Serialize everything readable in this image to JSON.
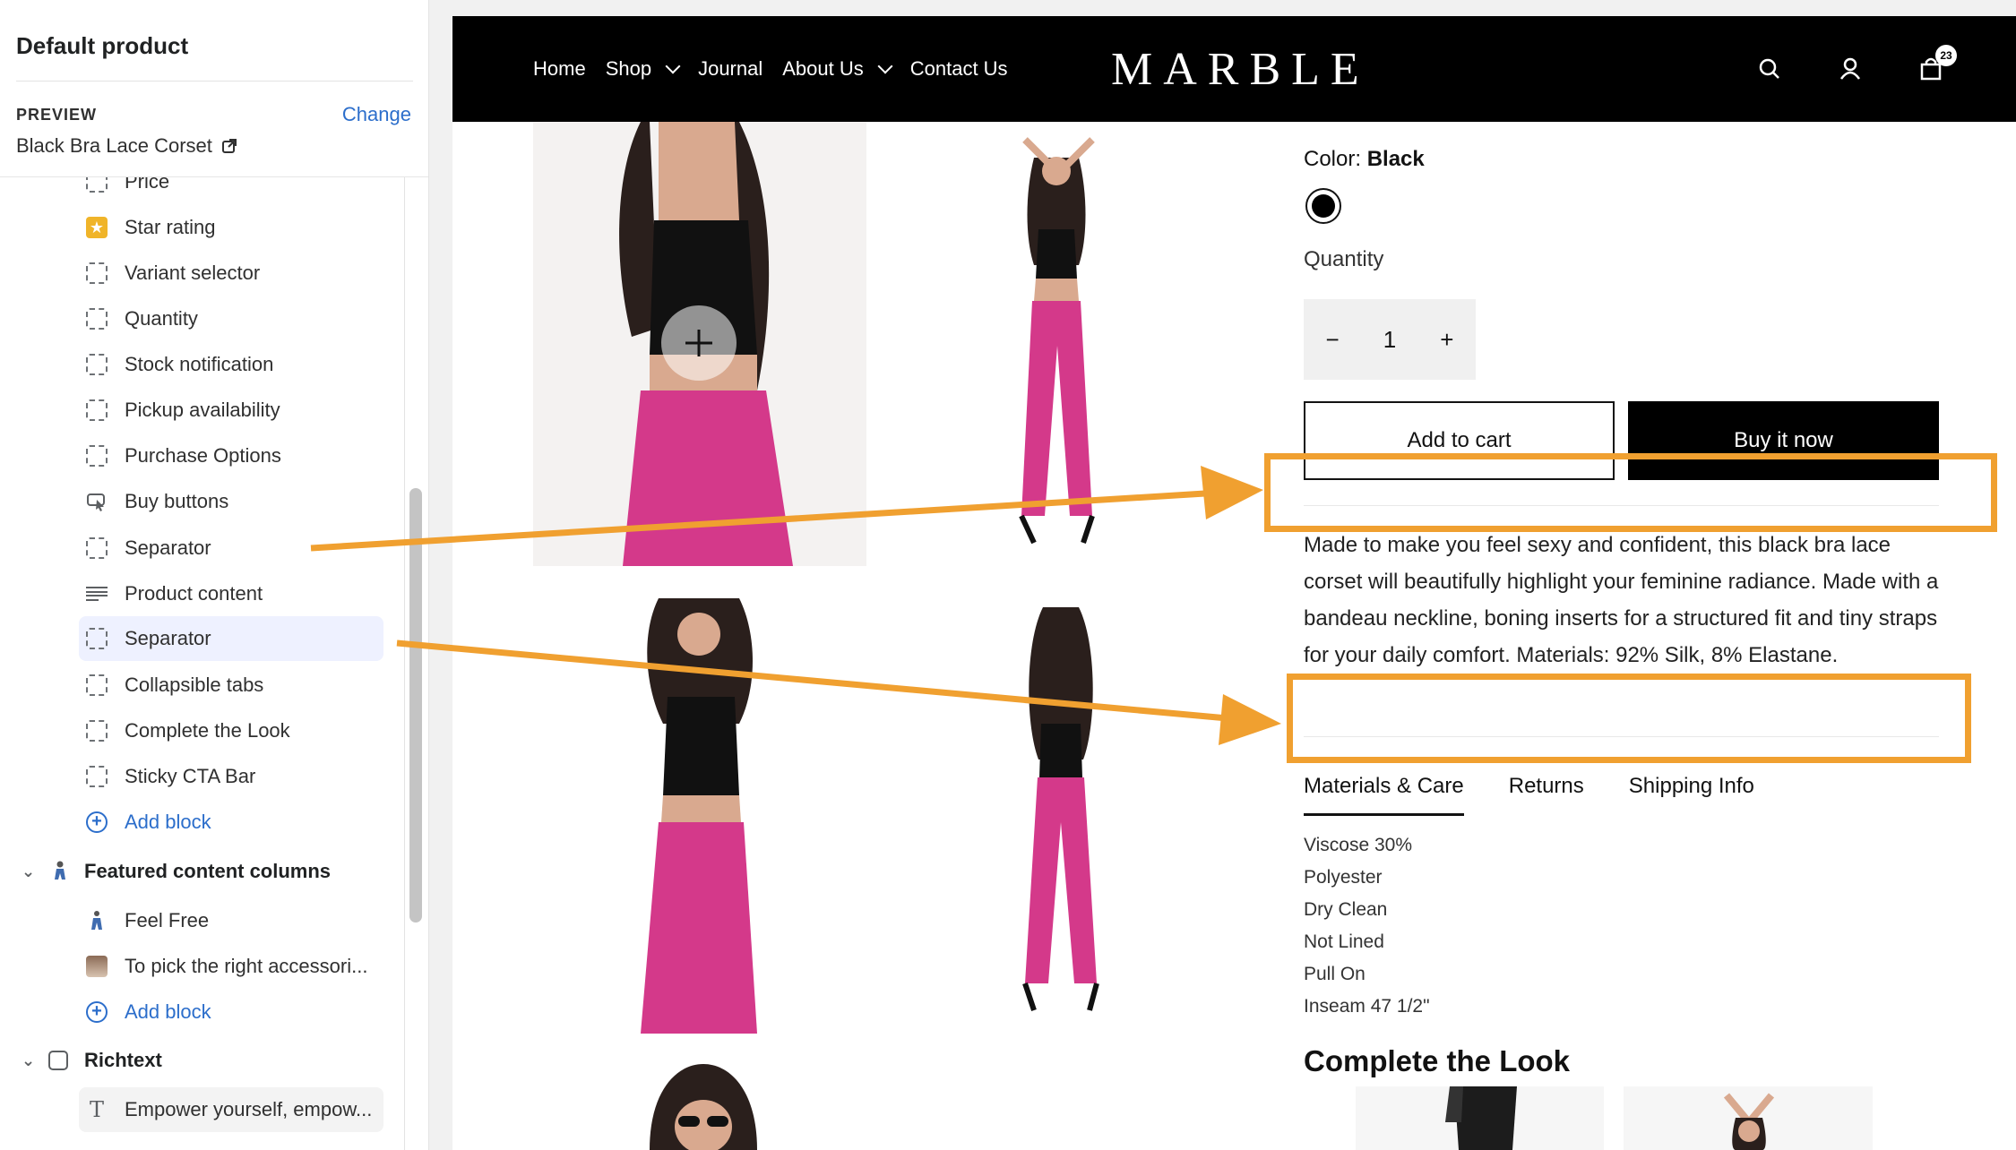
{
  "sidebar": {
    "title": "Default product",
    "preview_label": "PREVIEW",
    "change_label": "Change",
    "preview_value": "Black Bra Lace Corset",
    "items": [
      {
        "label": "Price",
        "icon": "dashed-square-icon"
      },
      {
        "label": "Star rating",
        "icon": "star-icon"
      },
      {
        "label": "Variant selector",
        "icon": "dashed-square-icon"
      },
      {
        "label": "Quantity",
        "icon": "dashed-square-icon"
      },
      {
        "label": "Stock notification",
        "icon": "dashed-square-icon"
      },
      {
        "label": "Pickup availability",
        "icon": "dashed-square-icon"
      },
      {
        "label": "Purchase Options",
        "icon": "dashed-square-icon"
      },
      {
        "label": "Buy buttons",
        "icon": "cursor-click-icon"
      },
      {
        "label": "Separator",
        "icon": "dashed-square-icon"
      },
      {
        "label": "Product content",
        "icon": "text-lines-icon"
      },
      {
        "label": "Separator",
        "icon": "dashed-square-icon"
      },
      {
        "label": "Collapsible tabs",
        "icon": "dashed-square-icon"
      },
      {
        "label": "Complete the Look",
        "icon": "dashed-square-icon"
      },
      {
        "label": "Sticky CTA Bar",
        "icon": "dashed-square-icon"
      }
    ],
    "add_block": "Add block",
    "section_featured": "Featured content columns",
    "featured_items": [
      "Feel Free",
      "To pick the right accessori..."
    ],
    "section_richtext": "Richtext",
    "richtext_items": [
      "Empower yourself, empow..."
    ]
  },
  "store": {
    "nav": [
      "Home",
      "Shop",
      "Journal",
      "About Us",
      "Contact Us"
    ],
    "logo": "MARBLE",
    "cart_count": "23"
  },
  "product": {
    "color_label": "Color:",
    "color_value": "Black",
    "quantity_label": "Quantity",
    "qty_minus": "−",
    "qty_value": "1",
    "qty_plus": "+",
    "add_to_cart": "Add to cart",
    "buy_now": "Buy it now",
    "description": "Made to make you feel sexy and confident, this black bra lace corset will beautifully highlight your feminine radiance. Made with a bandeau neckline, boning inserts for a structured fit and tiny straps for your daily comfort. Materials: 92% Silk, 8% Elastane.",
    "tabs": [
      "Materials & Care",
      "Returns",
      "Shipping Info"
    ],
    "materials": [
      "Viscose 30%",
      "Polyester",
      "Dry Clean",
      "Not Lined",
      "Pull On",
      "Inseam 47 1/2\""
    ],
    "complete_look_title": "Complete the Look"
  },
  "colors": {
    "accent": "#2c6ecb",
    "annotation": "#f0a030",
    "pants": "#d4398a",
    "nav_bg": "#000000"
  }
}
